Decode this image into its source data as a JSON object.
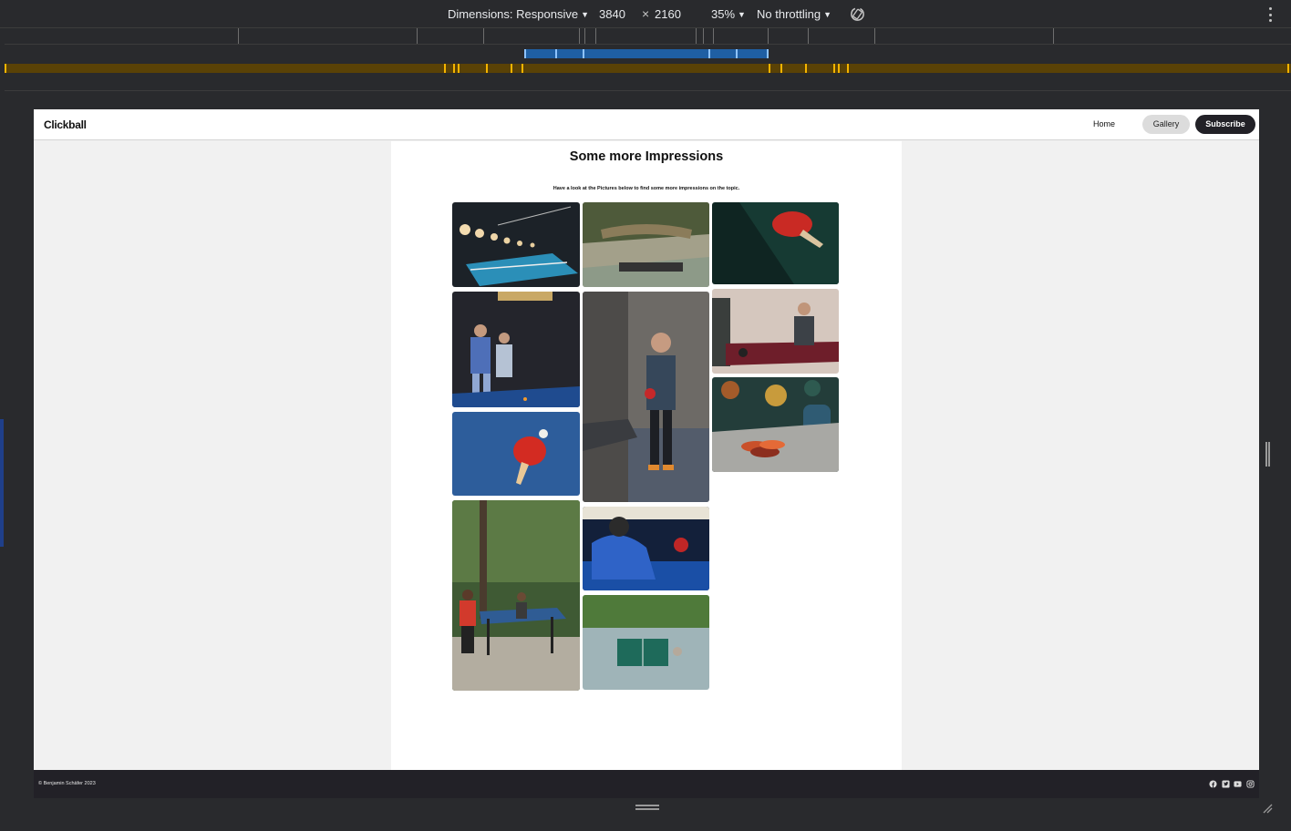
{
  "devtools": {
    "dimensions_label": "Dimensions: Responsive",
    "width": "3840",
    "times": "×",
    "height": "2160",
    "zoom": "35%",
    "throttling": "No throttling",
    "icons": [
      "rotate-icon",
      "kebab-menu-icon"
    ]
  },
  "site": {
    "brand": "Clickball",
    "nav": {
      "home": "Home",
      "gallery": "Gallery",
      "subscribe": "Subscribe"
    },
    "heading": "Some more Impressions",
    "subheading": "Have a look at the Pictures below to find some more impressions on the topic.",
    "footer": {
      "copyright": "© Benjamin Schäfer 2023",
      "social_icons": [
        "facebook-icon",
        "twitter-icon",
        "youtube-icon",
        "instagram-icon"
      ]
    }
  },
  "colors": {
    "nav_subscribe_bg": "#222127",
    "nav_gallery_bg": "#dcdcdc",
    "footer_bg": "#222127",
    "media_query_blue": "#1f5fa3",
    "media_query_orange": "#5a4206"
  },
  "gallery": [
    "table-tennis-hall-photo",
    "outdoor-table-net-photo",
    "red-paddle-green-table-photo",
    "two-players-dark-room-photo",
    "standing-player-photo",
    "office-players-photo",
    "red-paddle-blue-table-photo",
    "paddles-on-table-photo",
    "park-players-photo",
    "tournament-player-photo",
    "aerial-green-table-photo"
  ]
}
